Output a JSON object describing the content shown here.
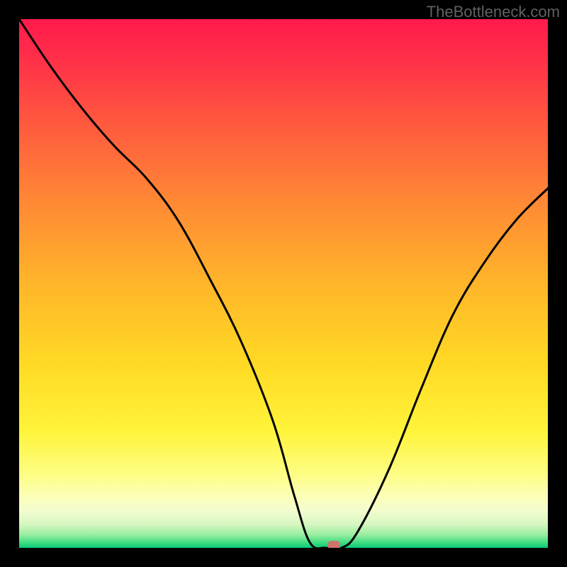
{
  "watermark": "TheBottleneck.com",
  "chart_data": {
    "type": "line",
    "title": "",
    "xlabel": "",
    "ylabel": "",
    "xlim": [
      0,
      100
    ],
    "ylim": [
      0,
      100
    ],
    "series": [
      {
        "name": "bottleneck-curve",
        "x": [
          0,
          6,
          12,
          18,
          24,
          30,
          36,
          42,
          48,
          52,
          55,
          58,
          61,
          64,
          70,
          76,
          82,
          88,
          94,
          100
        ],
        "values": [
          100,
          91,
          83,
          76,
          70,
          62,
          51,
          39,
          24,
          10,
          1,
          0,
          0,
          3,
          15,
          30,
          44,
          54,
          62,
          68
        ]
      }
    ],
    "marker": {
      "x": 59.5,
      "y": 0.5
    },
    "gradient_stops": [
      {
        "offset": 0,
        "color": "#ff1a4b"
      },
      {
        "offset": 0.07,
        "color": "#ff2e49"
      },
      {
        "offset": 0.2,
        "color": "#ff5a3e"
      },
      {
        "offset": 0.35,
        "color": "#ff8a34"
      },
      {
        "offset": 0.5,
        "color": "#ffb52a"
      },
      {
        "offset": 0.65,
        "color": "#ffd924"
      },
      {
        "offset": 0.78,
        "color": "#fff43a"
      },
      {
        "offset": 0.86,
        "color": "#fdfd83"
      },
      {
        "offset": 0.9,
        "color": "#fcffb5"
      },
      {
        "offset": 0.93,
        "color": "#f3fccf"
      },
      {
        "offset": 0.955,
        "color": "#d8f6c2"
      },
      {
        "offset": 0.975,
        "color": "#9aeea0"
      },
      {
        "offset": 0.99,
        "color": "#3fdc82"
      },
      {
        "offset": 1.0,
        "color": "#08c97a"
      }
    ]
  }
}
